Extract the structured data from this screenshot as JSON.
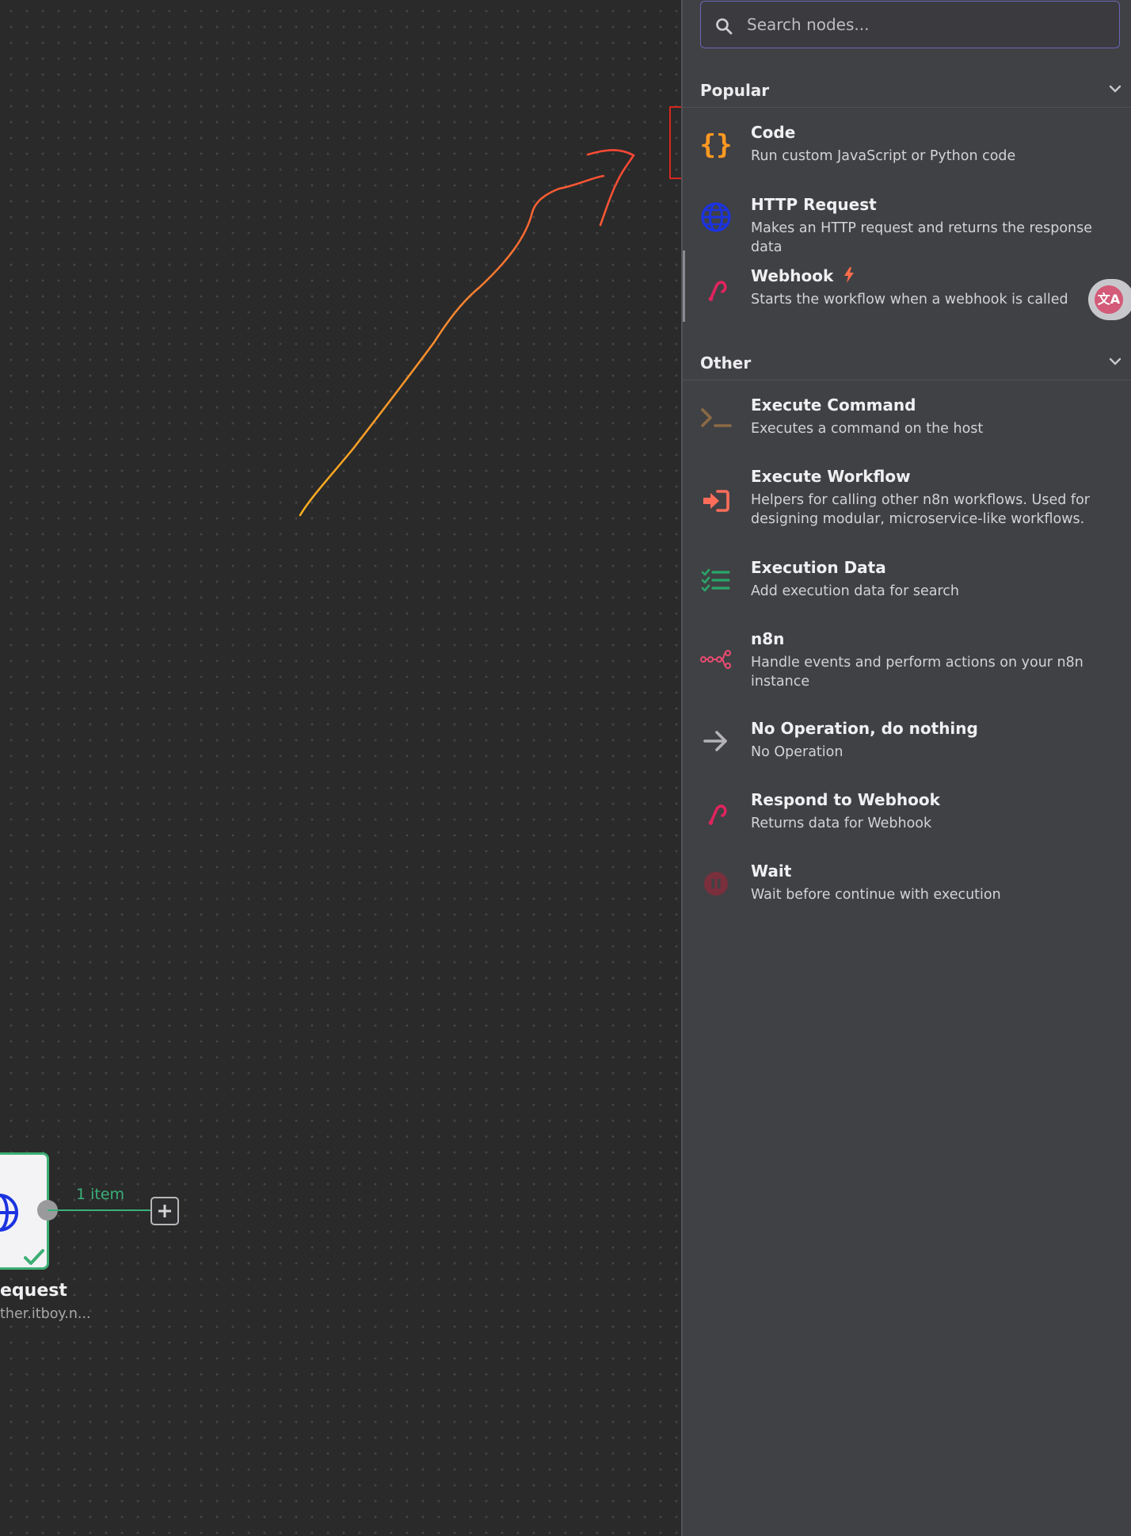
{
  "search": {
    "placeholder": "Search nodes..."
  },
  "categories": [
    {
      "label": "Popular",
      "nodes": [
        {
          "title": "Code",
          "description": "Run custom JavaScript or Python code",
          "icon": "code-braces-icon",
          "color": "#ff9922"
        },
        {
          "title": "HTTP Request",
          "description": "Makes an HTTP request and returns the response data",
          "icon": "globe-icon",
          "color": "#1b33e0"
        },
        {
          "title": "Webhook",
          "description": "Starts the workflow when a webhook is called",
          "icon": "webhook-icon",
          "color": "#e0245e",
          "badge_icon": "lightning-icon",
          "badge_color": "#ff6d4a"
        }
      ]
    },
    {
      "label": "Other",
      "nodes": [
        {
          "title": "Execute Command",
          "description": "Executes a command on the host",
          "icon": "terminal-icon",
          "color": "#8a6a45"
        },
        {
          "title": "Execute Workflow",
          "description": "Helpers for calling other n8n workflows. Used for designing modular, microservice-like workflows.",
          "icon": "sign-in-icon",
          "color": "#ff6d5a"
        },
        {
          "title": "Execution Data",
          "description": "Add execution data for search",
          "icon": "tasks-icon",
          "color": "#29a568"
        },
        {
          "title": "n8n",
          "description": "Handle events and perform actions on your n8n instance",
          "icon": "n8n-logo-icon",
          "color": "#ea4b71"
        },
        {
          "title": "No Operation, do nothing",
          "description": "No Operation",
          "icon": "arrow-right-icon",
          "color": "#b4b4b8"
        },
        {
          "title": "Respond to Webhook",
          "description": "Returns data for Webhook",
          "icon": "webhook-icon",
          "color": "#e0245e"
        },
        {
          "title": "Wait",
          "description": "Wait before continue with execution",
          "icon": "pause-circle-icon",
          "color": "#7a2f3c"
        }
      ]
    }
  ],
  "workflow_node": {
    "title": "equest",
    "subtitle": "ther.itboy.n...",
    "output_label": "1 item",
    "status": "success"
  },
  "translate_button": {
    "label": "文A"
  },
  "colors": {
    "canvas_bg": "#2a2a2a",
    "panel_bg": "#404144",
    "highlight_box": "#d6261f",
    "success": "#3ab07a",
    "annotation_arrow": "#ff6040"
  }
}
